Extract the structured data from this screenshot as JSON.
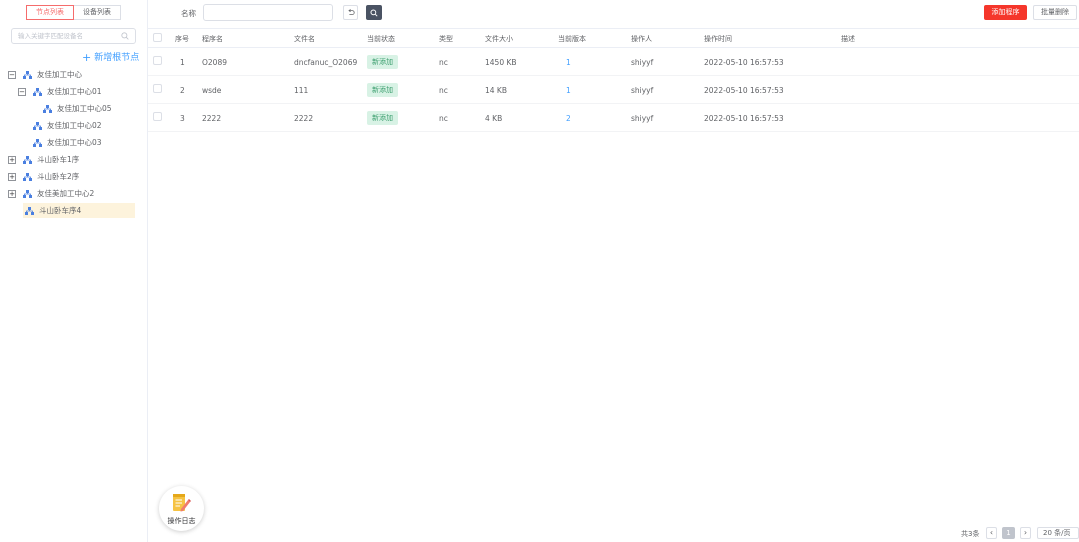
{
  "sidebar": {
    "tabs": [
      {
        "label": "节点列表",
        "active": true
      },
      {
        "label": "设备列表",
        "active": false
      }
    ],
    "search_placeholder": "输入关键字匹配设备名",
    "new_root_label": "新增根节点",
    "tree": [
      {
        "label": "友佳加工中心",
        "expander": "minus"
      },
      {
        "label": "友佳加工中心01",
        "expander": "minus"
      },
      {
        "label": "友佳加工中心05",
        "expander": "none"
      },
      {
        "label": "友佳加工中心02",
        "expander": "none"
      },
      {
        "label": "友佳加工中心03",
        "expander": "none"
      },
      {
        "label": "斗山卧车1序",
        "expander": "plus"
      },
      {
        "label": "斗山卧车2序",
        "expander": "plus"
      },
      {
        "label": "友佳美加工中心2",
        "expander": "plus"
      },
      {
        "label": "斗山卧车序4",
        "expander": "none",
        "selected": true
      }
    ]
  },
  "toolbar": {
    "name_label": "名称",
    "name_value": "",
    "add_label": "添加程序",
    "batch_delete_label": "批量删除"
  },
  "table": {
    "columns": [
      "序号",
      "程序名",
      "文件名",
      "当前状态",
      "类型",
      "文件大小",
      "当前版本",
      "操作人",
      "操作时间",
      "描述"
    ],
    "rows": [
      {
        "index": "1",
        "program": "O2089",
        "file": "dncfanuc_O2069",
        "status": "新添加",
        "type": "nc",
        "size": "1450 KB",
        "version": "1",
        "operator": "shiyyf",
        "time": "2022-05-10 16:57:53",
        "desc": ""
      },
      {
        "index": "2",
        "program": "wsde",
        "file": "111",
        "status": "新添加",
        "type": "nc",
        "size": "14 KB",
        "version": "1",
        "operator": "shiyyf",
        "time": "2022-05-10 16:57:53",
        "desc": ""
      },
      {
        "index": "3",
        "program": "2222",
        "file": "2222",
        "status": "新添加",
        "type": "nc",
        "size": "4 KB",
        "version": "2",
        "operator": "shiyyf",
        "time": "2022-05-10 16:57:53",
        "desc": ""
      }
    ]
  },
  "oplog": {
    "label": "操作日志"
  },
  "pagination": {
    "total": "共3条",
    "current_page": "1",
    "page_size": "20 条/页"
  },
  "colors": {
    "accent": "#f5362b",
    "link": "#409eff",
    "tag_bg": "#d8f2e5"
  }
}
